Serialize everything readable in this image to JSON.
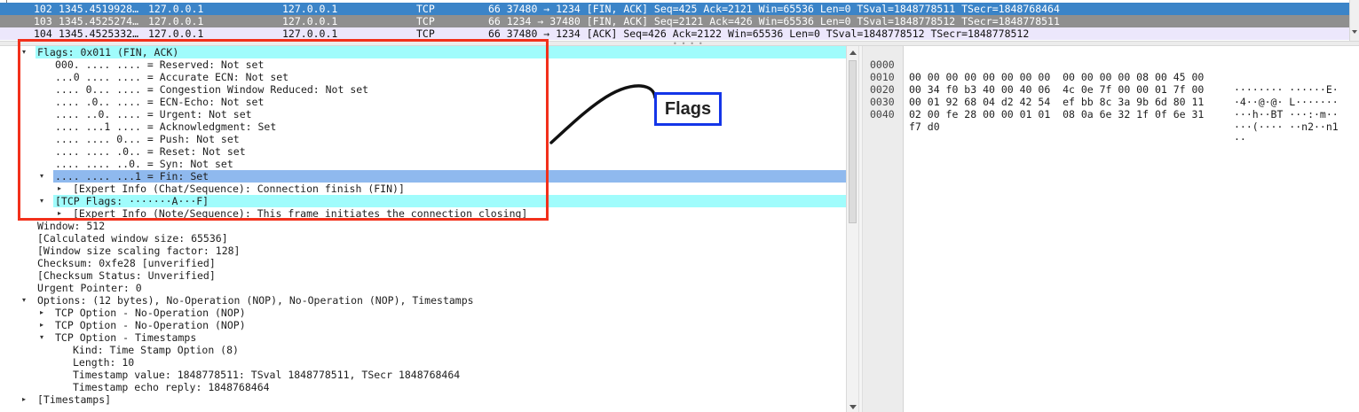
{
  "packet_list": {
    "rows": [
      {
        "no": "102",
        "time": "1345.4519928…",
        "src": "127.0.0.1",
        "dst": "127.0.0.1",
        "proto": "TCP",
        "info": "66 37480 → 1234 [FIN, ACK] Seq=425 Ack=2121 Win=65536 Len=0 TSval=1848778511 TSecr=1848768464"
      },
      {
        "no": "103",
        "time": "1345.4525274…",
        "src": "127.0.0.1",
        "dst": "127.0.0.1",
        "proto": "TCP",
        "info": "66 1234 → 37480 [FIN, ACK] Seq=2121 Ack=426 Win=65536 Len=0 TSval=1848778512 TSecr=1848778511"
      },
      {
        "no": "104",
        "time": "1345.4525332…",
        "src": "127.0.0.1",
        "dst": "127.0.0.1",
        "proto": "TCP",
        "info": "66 37480 → 1234 [ACK] Seq=426 Ack=2122 Win=65536 Len=0 TSval=1848778512 TSecr=1848778512"
      }
    ]
  },
  "details": {
    "rows": [
      {
        "text": "Flags: 0x011 (FIN, ACK)",
        "toggle": "▾"
      },
      {
        "text": "000. .... .... = Reserved: Not set",
        "toggle": ""
      },
      {
        "text": "...0 .... .... = Accurate ECN: Not set",
        "toggle": ""
      },
      {
        "text": ".... 0... .... = Congestion Window Reduced: Not set",
        "toggle": ""
      },
      {
        "text": ".... .0.. .... = ECN-Echo: Not set",
        "toggle": ""
      },
      {
        "text": ".... ..0. .... = Urgent: Not set",
        "toggle": ""
      },
      {
        "text": ".... ...1 .... = Acknowledgment: Set",
        "toggle": ""
      },
      {
        "text": ".... .... 0... = Push: Not set",
        "toggle": ""
      },
      {
        "text": ".... .... .0.. = Reset: Not set",
        "toggle": ""
      },
      {
        "text": ".... .... ..0. = Syn: Not set",
        "toggle": ""
      },
      {
        "text": ".... .... ...1 = Fin: Set",
        "toggle": "▾"
      },
      {
        "text": "[Expert Info (Chat/Sequence): Connection finish (FIN)]",
        "toggle": "▸"
      },
      {
        "text": "[TCP Flags: ·······A···F]",
        "toggle": "▾"
      },
      {
        "text": "[Expert Info (Note/Sequence): This frame initiates the connection closing]",
        "toggle": "▸"
      },
      {
        "text": "Window: 512",
        "toggle": ""
      },
      {
        "text": "[Calculated window size: 65536]",
        "toggle": ""
      },
      {
        "text": "[Window size scaling factor: 128]",
        "toggle": ""
      },
      {
        "text": "Checksum: 0xfe28 [unverified]",
        "toggle": ""
      },
      {
        "text": "[Checksum Status: Unverified]",
        "toggle": ""
      },
      {
        "text": "Urgent Pointer: 0",
        "toggle": ""
      },
      {
        "text": "Options: (12 bytes), No-Operation (NOP), No-Operation (NOP), Timestamps",
        "toggle": "▾"
      },
      {
        "text": "TCP Option - No-Operation (NOP)",
        "toggle": "▸"
      },
      {
        "text": "TCP Option - No-Operation (NOP)",
        "toggle": "▸"
      },
      {
        "text": "TCP Option - Timestamps",
        "toggle": "▾"
      },
      {
        "text": "Kind: Time Stamp Option (8)",
        "toggle": ""
      },
      {
        "text": "Length: 10",
        "toggle": ""
      },
      {
        "text": "Timestamp value: 1848778511: TSval 1848778511, TSecr 1848768464",
        "toggle": ""
      },
      {
        "text": "Timestamp echo reply: 1848768464",
        "toggle": ""
      },
      {
        "text": "[Timestamps]",
        "toggle": "▸"
      }
    ]
  },
  "bytes": {
    "rows": [
      {
        "offset": "0000",
        "hex": "00 00 00 00 00 00 00 00  00 00 00 00 08 00 45 00",
        "ascii": "········ ······E·"
      },
      {
        "offset": "0010",
        "hex": "00 34 f0 b3 40 00 40 06  4c 0e 7f 00 00 01 7f 00",
        "ascii": "·4··@·@· L·······"
      },
      {
        "offset": "0020",
        "hex": "00 01 92 68 04 d2 42 54  ef bb 8c 3a 9b 6d 80 11",
        "ascii": "···h··BT ···:·m··"
      },
      {
        "offset": "0030",
        "hex": "02 00 fe 28 00 00 01 01  08 0a 6e 32 1f 0f 6e 31",
        "ascii": "···(···· ··n2··n1"
      },
      {
        "offset": "0040",
        "hex": "f7 d0",
        "ascii": "··"
      }
    ]
  },
  "annotation": {
    "label": "Flags",
    "box_color": "#f2301b",
    "label_border_color": "#1435e8"
  },
  "colors": {
    "selected_row": "#3b84c8",
    "highlight_cyan": "#a0fcfc",
    "highlight_blue": "#8fb9ee"
  }
}
